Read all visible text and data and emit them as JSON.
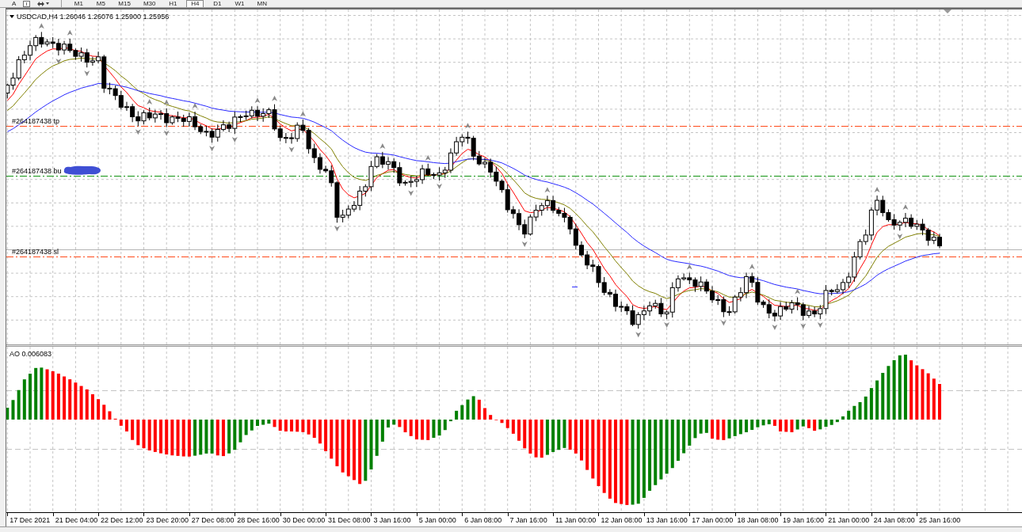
{
  "toolbar": {
    "text_tool": "A",
    "timeframes": [
      {
        "label": "M1",
        "selected": false
      },
      {
        "label": "M5",
        "selected": false
      },
      {
        "label": "M15",
        "selected": false
      },
      {
        "label": "M30",
        "selected": false
      },
      {
        "label": "H1",
        "selected": false
      },
      {
        "label": "H4",
        "selected": true
      },
      {
        "label": "D1",
        "selected": false
      },
      {
        "label": "W1",
        "selected": false
      },
      {
        "label": "MN",
        "selected": false
      }
    ]
  },
  "main_chart": {
    "title": "USDCAD,H4 1.26046 1.26076 1.25900 1.25956",
    "order_lines": [
      {
        "kind": "tp",
        "label": "#264187438 tp",
        "redacted": false
      },
      {
        "kind": "entry",
        "label": "#264187438 bu",
        "redacted": true
      },
      {
        "kind": "sl",
        "label": "#264187438 sl",
        "redacted": false
      }
    ]
  },
  "indicator": {
    "title": "AO 0.006083"
  },
  "time_axis": {
    "labels": [
      "17 Dec 2021",
      "21 Dec 04:00",
      "22 Dec 12:00",
      "23 Dec 20:00",
      "27 Dec 08:00",
      "28 Dec 16:00",
      "30 Dec 00:00",
      "31 Dec 08:00",
      "3 Jan 16:00",
      "5 Jan 00:00",
      "6 Jan 08:00",
      "7 Jan 16:00",
      "11 Jan 00:00",
      "12 Jan 08:00",
      "13 Jan 16:00",
      "17 Jan 00:00",
      "18 Jan 08:00",
      "19 Jan 16:00",
      "21 Jan 00:00",
      "24 Jan 08:00",
      "25 Jan 16:00"
    ]
  }
}
